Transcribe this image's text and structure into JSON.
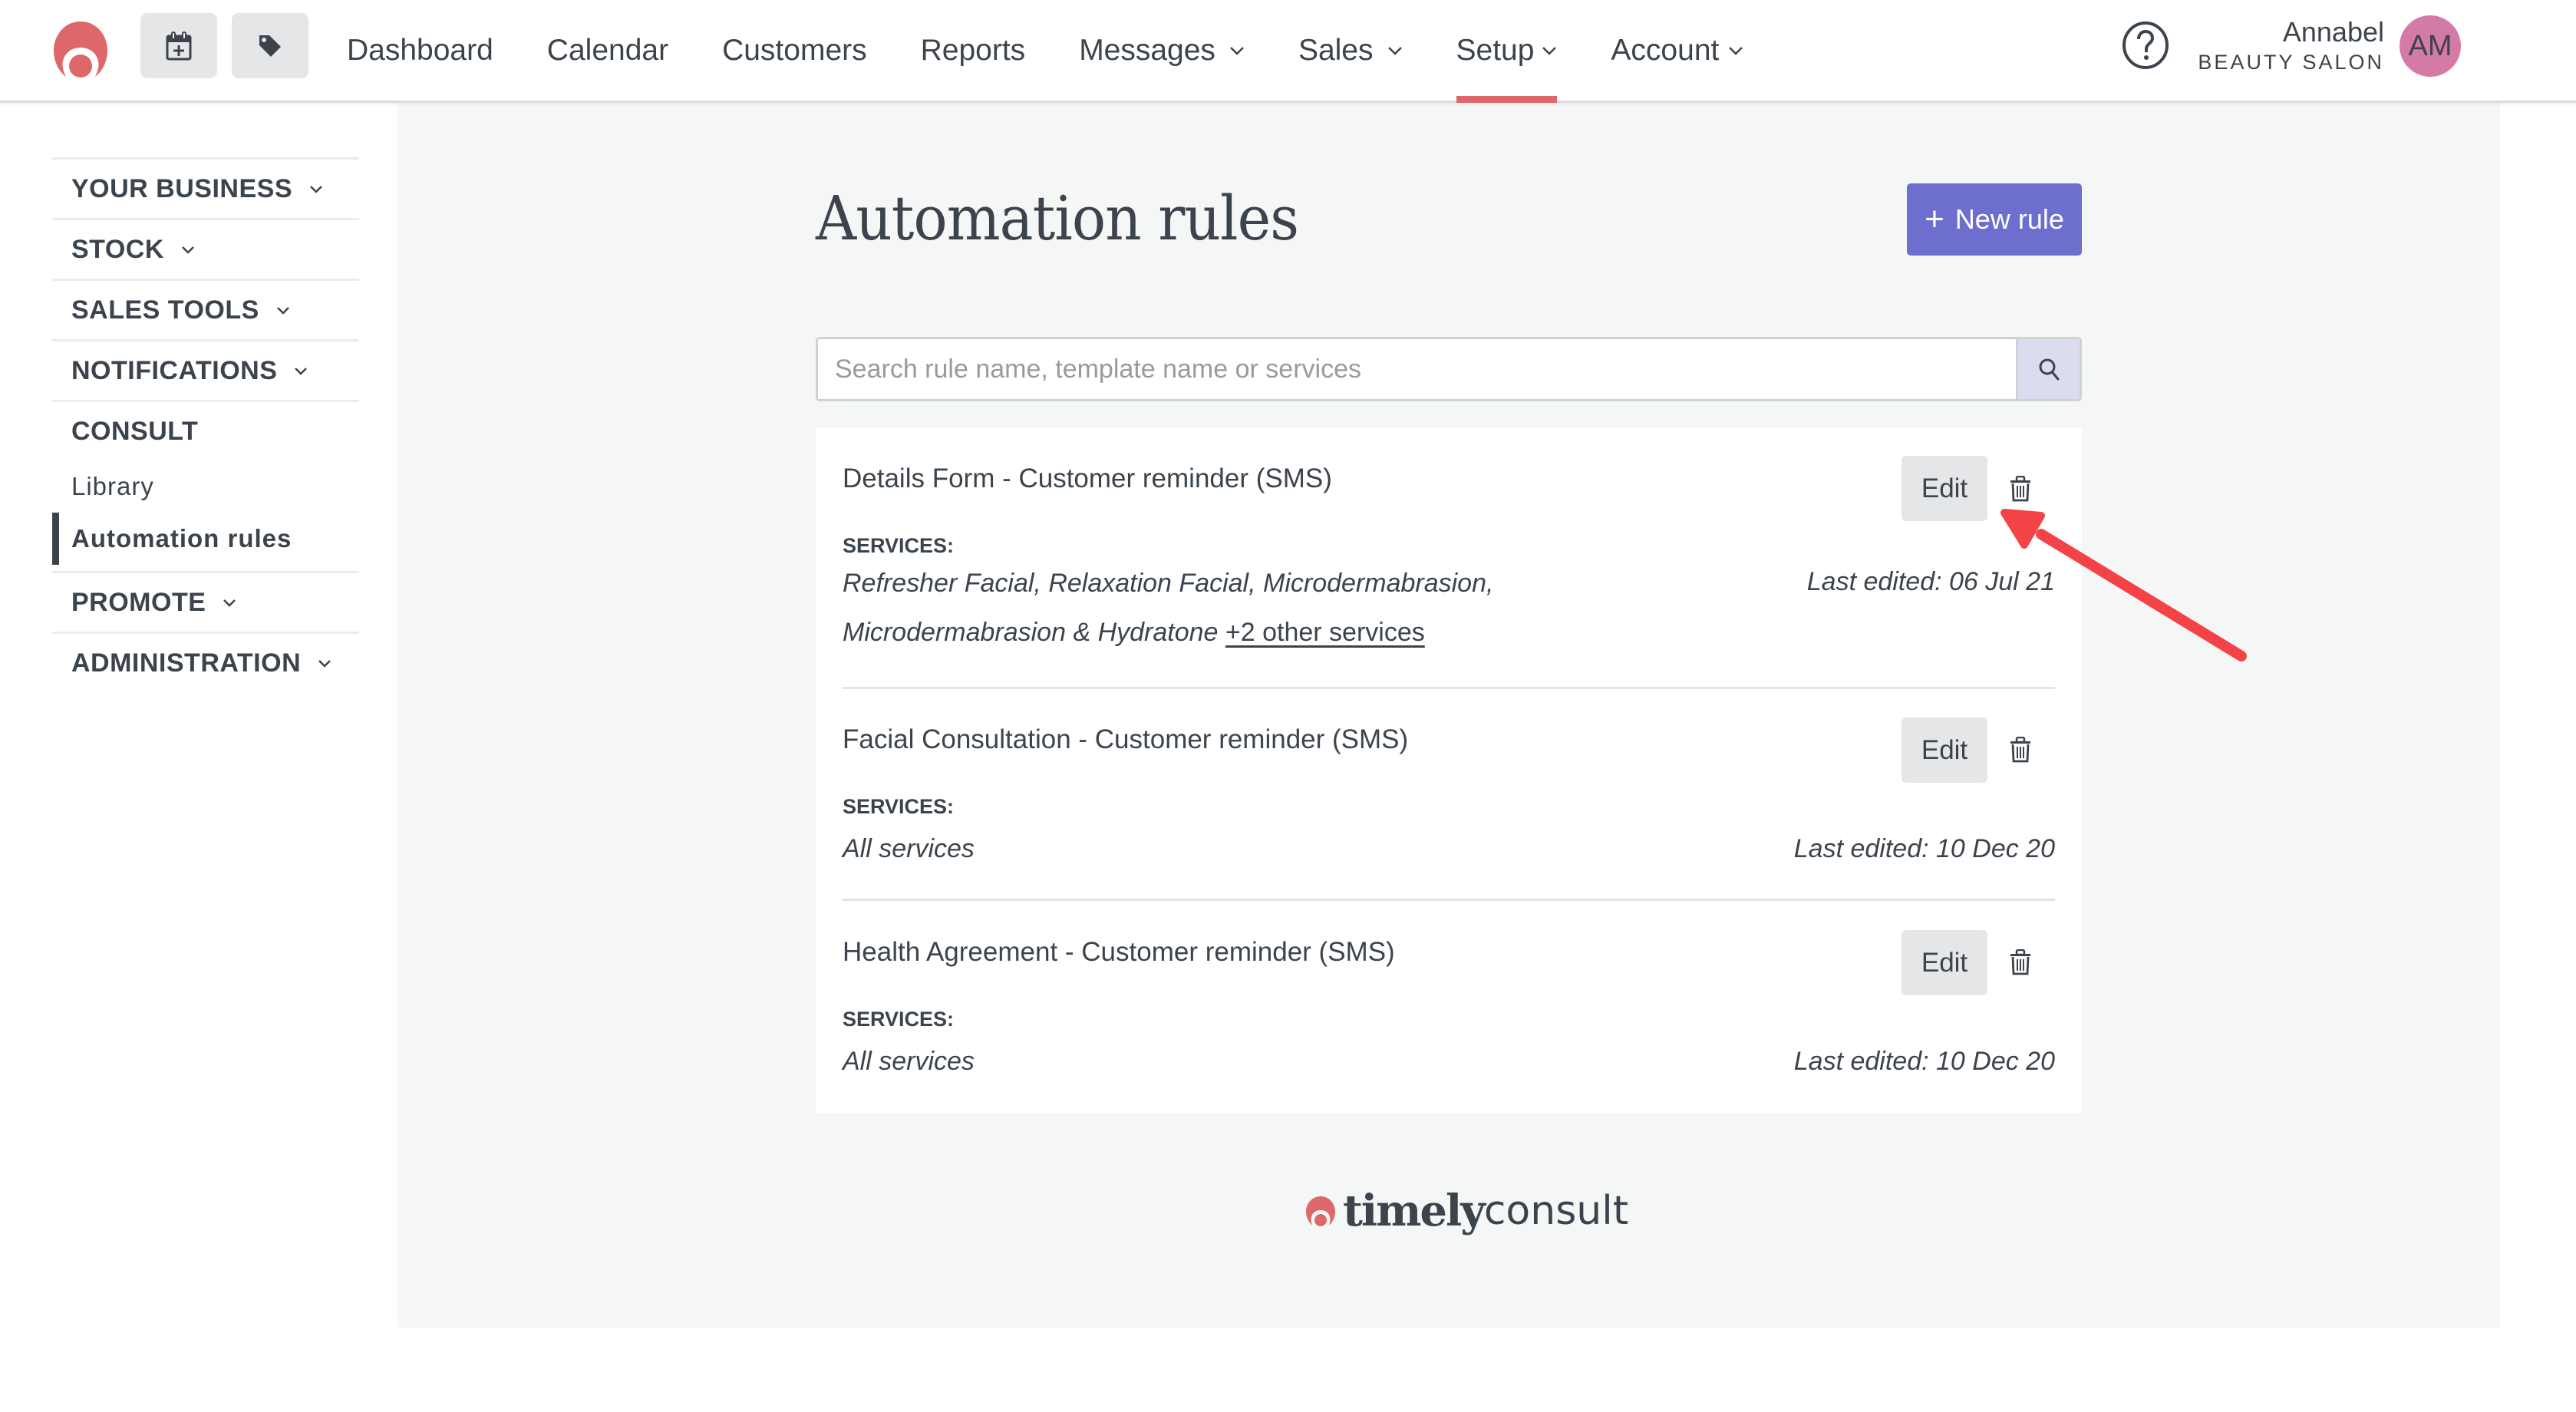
{
  "header": {
    "logo": "timely-logo",
    "quick_actions": [
      {
        "icon": "calendar-add-icon",
        "label": "New appointment"
      },
      {
        "icon": "tag-icon",
        "label": "New sale"
      }
    ],
    "nav": [
      {
        "label": "Dashboard",
        "dropdown": false,
        "active": false
      },
      {
        "label": "Calendar",
        "dropdown": false,
        "active": false
      },
      {
        "label": "Customers",
        "dropdown": false,
        "active": false
      },
      {
        "label": "Reports",
        "dropdown": false,
        "active": false
      },
      {
        "label": "Messages",
        "dropdown": true,
        "active": false
      },
      {
        "label": "Sales",
        "dropdown": true,
        "active": false
      },
      {
        "label": "Setup",
        "dropdown": true,
        "active": true
      },
      {
        "label": "Account",
        "dropdown": true,
        "active": false
      }
    ],
    "help_icon": "question-circle-icon",
    "user": {
      "name": "Annabel",
      "business": "BEAUTY SALON",
      "initials": "AM",
      "avatar_color": "#d37ba6"
    },
    "active_indicator_color": "#dd6769"
  },
  "sidebar": {
    "sections": [
      {
        "label": "YOUR BUSINESS",
        "collapsible": true
      },
      {
        "label": "STOCK",
        "collapsible": true
      },
      {
        "label": "SALES TOOLS",
        "collapsible": true
      },
      {
        "label": "NOTIFICATIONS",
        "collapsible": true
      },
      {
        "label": "CONSULT",
        "collapsible": false,
        "children": [
          {
            "label": "Library",
            "active": false
          },
          {
            "label": "Automation rules",
            "active": true
          }
        ]
      },
      {
        "label": "PROMOTE",
        "collapsible": true
      },
      {
        "label": "ADMINISTRATION",
        "collapsible": true
      }
    ]
  },
  "main": {
    "title": "Automation rules",
    "new_rule_button": {
      "icon": "plus",
      "label": "New rule",
      "color": "#6e6ecf"
    },
    "search": {
      "placeholder": "Search rule name, template name or services",
      "value": ""
    },
    "rules": [
      {
        "title": "Details Form - Customer reminder (SMS)",
        "services_label": "SERVICES:",
        "services": "Refresher Facial, Relaxation Facial, Microdermabrasion, Microdermabrasion & Hydratone",
        "more_services": "+2 other services",
        "last_edited": "Last edited: 06 Jul 21",
        "edit_label": "Edit"
      },
      {
        "title": "Facial Consultation - Customer reminder (SMS)",
        "services_label": "SERVICES:",
        "services": "All services",
        "more_services": "",
        "last_edited": "Last edited: 10 Dec 20",
        "edit_label": "Edit"
      },
      {
        "title": "Health Agreement - Customer reminder (SMS)",
        "services_label": "SERVICES:",
        "services": "All services",
        "more_services": "",
        "last_edited": "Last edited: 10 Dec 20",
        "edit_label": "Edit"
      }
    ],
    "footer_logo": {
      "bold": "timely",
      "light": "consult"
    }
  },
  "annotation": {
    "type": "arrow",
    "color": "#f44346",
    "points_to": "rule-1-edit-button"
  }
}
